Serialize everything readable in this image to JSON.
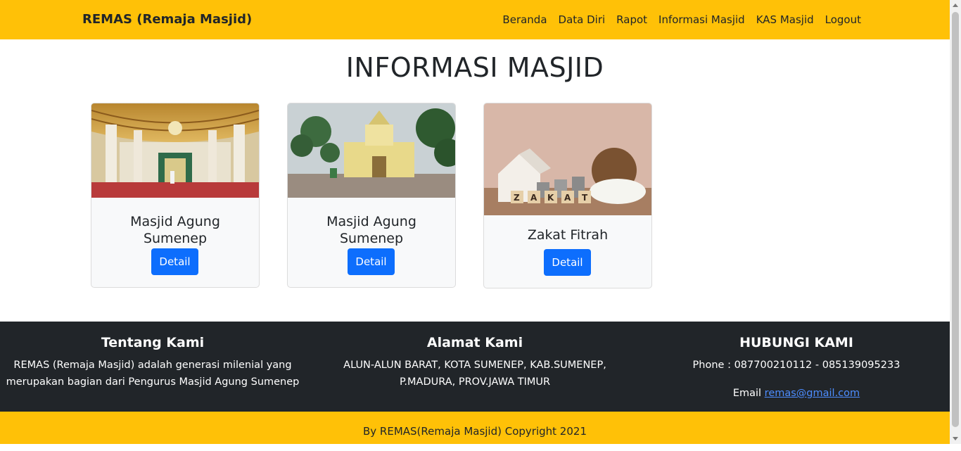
{
  "navbar": {
    "brand": "REMAS (Remaja Masjid)",
    "links": [
      "Beranda",
      "Data Diri",
      "Rapot",
      "Informasi Masjid",
      "KAS Masjid",
      "Logout"
    ]
  },
  "main": {
    "title": "INFORMASI MASJID",
    "cards": [
      {
        "title": "Masjid Agung Sumenep",
        "button": "Detail",
        "image": "mosque-interior-photo"
      },
      {
        "title": "Masjid Agung Sumenep",
        "button": "Detail",
        "image": "mosque-gate-photo"
      },
      {
        "title": "Zakat Fitrah",
        "button": "Detail",
        "image": "zakat-house-rice-photo",
        "image_text": "ZAKAT"
      }
    ]
  },
  "footer": {
    "about": {
      "heading": "Tentang Kami",
      "line1": "REMAS (Remaja Masjid) adalah generasi milenial yang",
      "line2": "merupakan bagian dari Pengurus Masjid Agung Sumenep"
    },
    "address": {
      "heading": "Alamat Kami",
      "line1": "ALUN-ALUN BARAT, KOTA SUMENEP, KAB.SUMENEP,",
      "line2": "P.MADURA, PROV.JAWA TIMUR"
    },
    "contact": {
      "heading": "HUBUNGI KAMI",
      "phone": "Phone : 087700210112 - 085139095233",
      "email_label": "Email",
      "email": "remas@gmail.com"
    }
  },
  "copyright": "By REMAS(Remaja Masjid) Copyright 2021",
  "colors": {
    "navbar": "#ffc107",
    "button": "#0d6efd",
    "footer": "#212529"
  }
}
